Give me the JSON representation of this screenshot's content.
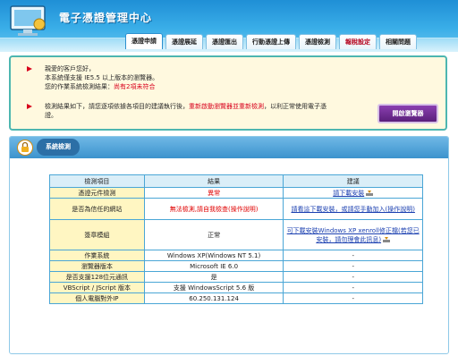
{
  "header": {
    "title": "電子憑證管理中心"
  },
  "tabs": [
    {
      "label": "憑證申請",
      "active": true
    },
    {
      "label": "憑證展延"
    },
    {
      "label": "憑證匯出"
    },
    {
      "label": "行動憑證上傳"
    },
    {
      "label": "憑證檢測"
    },
    {
      "label": "報稅設定",
      "red": true
    },
    {
      "label": "相關問題"
    }
  ],
  "notice": {
    "line1": "親愛的客戶您好，",
    "line2": "本系統僅支援 IE5.5 以上版本的瀏覽器。",
    "line3_prefix": "您的作業系統檢測結果：",
    "line3_status": "尚有2項未符合",
    "line4_prefix": "檢測結果如下，請您逐項依據各項目的建議執行後，",
    "line4_red": "重新啟動瀏覽器並重新檢測",
    "line4_suffix": "，以利正常使用電子憑",
    "line5": "證。",
    "button": "開啟瀏覽器"
  },
  "check": {
    "title": "系統檢測",
    "headers": [
      "檢測項目",
      "結果",
      "建議"
    ],
    "rows": [
      {
        "item": "憑證元件檢測",
        "result": "異常",
        "result_err": true,
        "advice": "請下載安裝",
        "advice_link": true,
        "icon": "install-icon"
      },
      {
        "item": "是否為信任的網站",
        "result": "無法檢測,請自我檢查(操作說明)",
        "result_err": true,
        "advice": "請看這下載安裝，或請您手動加入(操作說明)",
        "advice_link": true
      },
      {
        "item": "簽章模組",
        "result": "正常",
        "advice": "可下載安裝Windows XP xenroll修正檔(若您已安裝，請勿理會此訊息)",
        "advice_link": true,
        "icon": "install-icon"
      },
      {
        "item": "作業系統",
        "result": "Windows XP(Windows NT 5.1)",
        "advice": "-"
      },
      {
        "item": "瀏覽器版本",
        "result": "Microsoft IE 6.0",
        "advice": "-"
      },
      {
        "item": "是否支援128位元通訊",
        "result": "是",
        "advice": "-"
      },
      {
        "item": "VBScript / JScript 版本",
        "result": "支援 WindowsScript 5.6 版",
        "advice": "-"
      },
      {
        "item": "個人電腦對外IP",
        "result": "60.250.131.124",
        "advice": "-"
      }
    ]
  },
  "colors": {
    "accent": "#2b8fcf",
    "error": "#e00000",
    "notice_bg": "#fff9df",
    "button": "#6a2b8f"
  }
}
